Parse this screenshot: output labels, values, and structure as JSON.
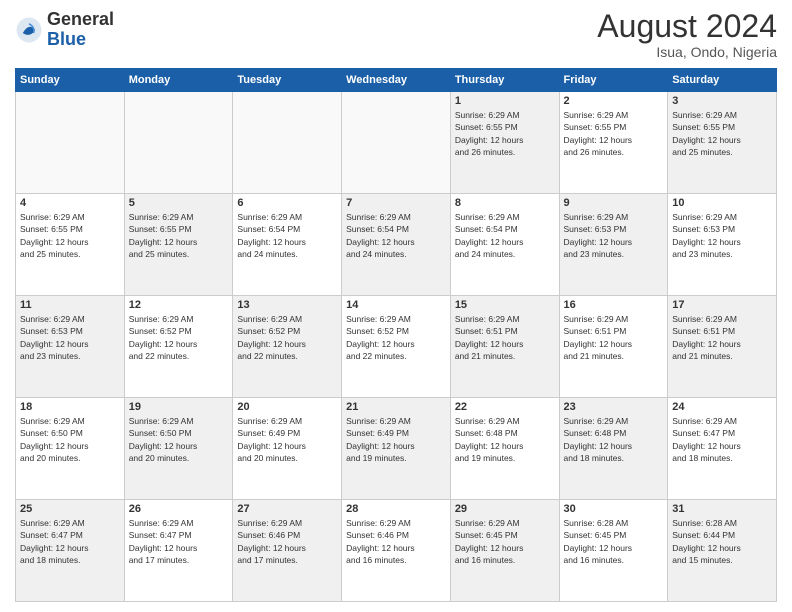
{
  "header": {
    "logo_line1": "General",
    "logo_line2": "Blue",
    "month_year": "August 2024",
    "location": "Isua, Ondo, Nigeria"
  },
  "days_of_week": [
    "Sunday",
    "Monday",
    "Tuesday",
    "Wednesday",
    "Thursday",
    "Friday",
    "Saturday"
  ],
  "weeks": [
    [
      {
        "day": "",
        "info": "",
        "empty": true
      },
      {
        "day": "",
        "info": "",
        "empty": true
      },
      {
        "day": "",
        "info": "",
        "empty": true
      },
      {
        "day": "",
        "info": "",
        "empty": true
      },
      {
        "day": "1",
        "info": "Sunrise: 6:29 AM\nSunset: 6:55 PM\nDaylight: 12 hours\nand 26 minutes.",
        "empty": false
      },
      {
        "day": "2",
        "info": "Sunrise: 6:29 AM\nSunset: 6:55 PM\nDaylight: 12 hours\nand 26 minutes.",
        "empty": false
      },
      {
        "day": "3",
        "info": "Sunrise: 6:29 AM\nSunset: 6:55 PM\nDaylight: 12 hours\nand 25 minutes.",
        "empty": false
      }
    ],
    [
      {
        "day": "4",
        "info": "Sunrise: 6:29 AM\nSunset: 6:55 PM\nDaylight: 12 hours\nand 25 minutes.",
        "empty": false
      },
      {
        "day": "5",
        "info": "Sunrise: 6:29 AM\nSunset: 6:55 PM\nDaylight: 12 hours\nand 25 minutes.",
        "empty": false
      },
      {
        "day": "6",
        "info": "Sunrise: 6:29 AM\nSunset: 6:54 PM\nDaylight: 12 hours\nand 24 minutes.",
        "empty": false
      },
      {
        "day": "7",
        "info": "Sunrise: 6:29 AM\nSunset: 6:54 PM\nDaylight: 12 hours\nand 24 minutes.",
        "empty": false
      },
      {
        "day": "8",
        "info": "Sunrise: 6:29 AM\nSunset: 6:54 PM\nDaylight: 12 hours\nand 24 minutes.",
        "empty": false
      },
      {
        "day": "9",
        "info": "Sunrise: 6:29 AM\nSunset: 6:53 PM\nDaylight: 12 hours\nand 23 minutes.",
        "empty": false
      },
      {
        "day": "10",
        "info": "Sunrise: 6:29 AM\nSunset: 6:53 PM\nDaylight: 12 hours\nand 23 minutes.",
        "empty": false
      }
    ],
    [
      {
        "day": "11",
        "info": "Sunrise: 6:29 AM\nSunset: 6:53 PM\nDaylight: 12 hours\nand 23 minutes.",
        "empty": false
      },
      {
        "day": "12",
        "info": "Sunrise: 6:29 AM\nSunset: 6:52 PM\nDaylight: 12 hours\nand 22 minutes.",
        "empty": false
      },
      {
        "day": "13",
        "info": "Sunrise: 6:29 AM\nSunset: 6:52 PM\nDaylight: 12 hours\nand 22 minutes.",
        "empty": false
      },
      {
        "day": "14",
        "info": "Sunrise: 6:29 AM\nSunset: 6:52 PM\nDaylight: 12 hours\nand 22 minutes.",
        "empty": false
      },
      {
        "day": "15",
        "info": "Sunrise: 6:29 AM\nSunset: 6:51 PM\nDaylight: 12 hours\nand 21 minutes.",
        "empty": false
      },
      {
        "day": "16",
        "info": "Sunrise: 6:29 AM\nSunset: 6:51 PM\nDaylight: 12 hours\nand 21 minutes.",
        "empty": false
      },
      {
        "day": "17",
        "info": "Sunrise: 6:29 AM\nSunset: 6:51 PM\nDaylight: 12 hours\nand 21 minutes.",
        "empty": false
      }
    ],
    [
      {
        "day": "18",
        "info": "Sunrise: 6:29 AM\nSunset: 6:50 PM\nDaylight: 12 hours\nand 20 minutes.",
        "empty": false
      },
      {
        "day": "19",
        "info": "Sunrise: 6:29 AM\nSunset: 6:50 PM\nDaylight: 12 hours\nand 20 minutes.",
        "empty": false
      },
      {
        "day": "20",
        "info": "Sunrise: 6:29 AM\nSunset: 6:49 PM\nDaylight: 12 hours\nand 20 minutes.",
        "empty": false
      },
      {
        "day": "21",
        "info": "Sunrise: 6:29 AM\nSunset: 6:49 PM\nDaylight: 12 hours\nand 19 minutes.",
        "empty": false
      },
      {
        "day": "22",
        "info": "Sunrise: 6:29 AM\nSunset: 6:48 PM\nDaylight: 12 hours\nand 19 minutes.",
        "empty": false
      },
      {
        "day": "23",
        "info": "Sunrise: 6:29 AM\nSunset: 6:48 PM\nDaylight: 12 hours\nand 18 minutes.",
        "empty": false
      },
      {
        "day": "24",
        "info": "Sunrise: 6:29 AM\nSunset: 6:47 PM\nDaylight: 12 hours\nand 18 minutes.",
        "empty": false
      }
    ],
    [
      {
        "day": "25",
        "info": "Sunrise: 6:29 AM\nSunset: 6:47 PM\nDaylight: 12 hours\nand 18 minutes.",
        "empty": false
      },
      {
        "day": "26",
        "info": "Sunrise: 6:29 AM\nSunset: 6:47 PM\nDaylight: 12 hours\nand 17 minutes.",
        "empty": false
      },
      {
        "day": "27",
        "info": "Sunrise: 6:29 AM\nSunset: 6:46 PM\nDaylight: 12 hours\nand 17 minutes.",
        "empty": false
      },
      {
        "day": "28",
        "info": "Sunrise: 6:29 AM\nSunset: 6:46 PM\nDaylight: 12 hours\nand 16 minutes.",
        "empty": false
      },
      {
        "day": "29",
        "info": "Sunrise: 6:29 AM\nSunset: 6:45 PM\nDaylight: 12 hours\nand 16 minutes.",
        "empty": false
      },
      {
        "day": "30",
        "info": "Sunrise: 6:28 AM\nSunset: 6:45 PM\nDaylight: 12 hours\nand 16 minutes.",
        "empty": false
      },
      {
        "day": "31",
        "info": "Sunrise: 6:28 AM\nSunset: 6:44 PM\nDaylight: 12 hours\nand 15 minutes.",
        "empty": false
      }
    ]
  ]
}
